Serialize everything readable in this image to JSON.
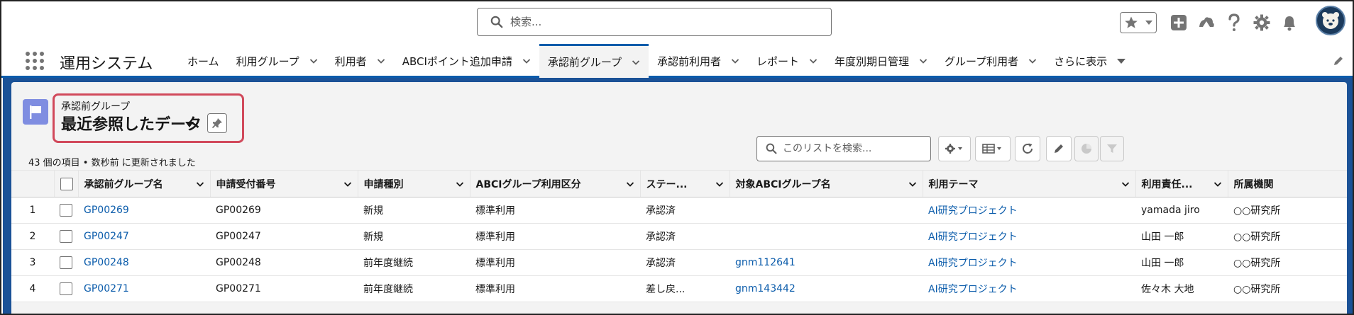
{
  "header": {
    "search_placeholder": "検索...",
    "icons": [
      "favorites-star-icon",
      "chevron-down-icon",
      "add-icon",
      "trailhead-icon",
      "help-icon",
      "setup-gear-icon",
      "notifications-bell-icon",
      "avatar"
    ]
  },
  "nav": {
    "app_name": "運用システム",
    "items": [
      {
        "label": "ホーム",
        "has_menu": false
      },
      {
        "label": "利用グループ",
        "has_menu": true
      },
      {
        "label": "利用者",
        "has_menu": true
      },
      {
        "label": "ABCIポイント追加申請",
        "has_menu": true
      },
      {
        "label": "承認前グループ",
        "has_menu": true,
        "active": true
      },
      {
        "label": "承認前利用者",
        "has_menu": true
      },
      {
        "label": "レポート",
        "has_menu": true
      },
      {
        "label": "年度別期日管理",
        "has_menu": true
      },
      {
        "label": "グループ利用者",
        "has_menu": true
      },
      {
        "label": "さらに表示",
        "has_menu": true
      }
    ]
  },
  "list_view": {
    "object_label": "承認前グループ",
    "view_name": "最近参照したデータ",
    "meta": "43 個の項目 • 数秒前 に更新されました",
    "search_placeholder": "このリストを検索...",
    "columns": [
      "承認前グループ名",
      "申請受付番号",
      "申請種別",
      "ABCIグループ利用区分",
      "ステー...",
      "対象ABCIグループ名",
      "利用テーマ",
      "利用責任...",
      "所属機関"
    ],
    "rows": [
      {
        "num": "1",
        "name": "GP00269",
        "receipt": "GP00269",
        "type": "新規",
        "usage": "標準利用",
        "status": "承認済",
        "target": "",
        "theme": "AI研究プロジェクト",
        "owner": "yamada jiro",
        "org": "○○研究所"
      },
      {
        "num": "2",
        "name": "GP00247",
        "receipt": "GP00247",
        "type": "新規",
        "usage": "標準利用",
        "status": "承認済",
        "target": "",
        "theme": "AI研究プロジェクト",
        "owner": "山田 一郎",
        "org": "○○研究所"
      },
      {
        "num": "3",
        "name": "GP00248",
        "receipt": "GP00248",
        "type": "前年度継続",
        "usage": "標準利用",
        "status": "承認済",
        "target": "gnm112641",
        "theme": "AI研究プロジェクト",
        "owner": "山田 一郎",
        "org": "○○研究所"
      },
      {
        "num": "4",
        "name": "GP00271",
        "receipt": "GP00271",
        "type": "前年度継続",
        "usage": "標準利用",
        "status": "差し戻...",
        "target": "gnm143442",
        "theme": "AI研究プロジェクト",
        "owner": "佐々木 大地",
        "org": "○○研究所"
      }
    ]
  },
  "colors": {
    "brand": "#0b5cab",
    "highlight_border": "#d1495b",
    "object_icon": "#7f8de1",
    "link": "#0b5cab"
  }
}
